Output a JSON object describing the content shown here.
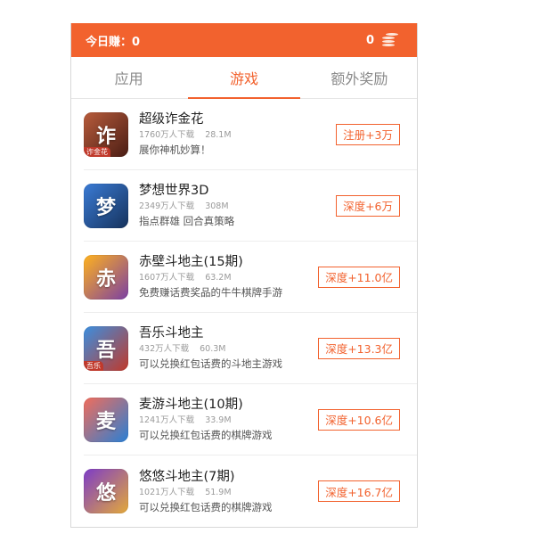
{
  "header": {
    "today_label": "今日赚：",
    "today_value": "0",
    "coin_value": "0",
    "coin_icon": "coin-stack-icon"
  },
  "tabs": [
    {
      "label": "应用",
      "active": false
    },
    {
      "label": "游戏",
      "active": true
    },
    {
      "label": "额外奖励",
      "active": false
    }
  ],
  "apps": [
    {
      "name": "超级诈金花",
      "downloads": "1760万人下载",
      "size": "28.1M",
      "desc": "展你神机妙算！",
      "reward": "注册+3万",
      "icon": "poker-girl-icon",
      "icon_text": "诈",
      "icon_badge": "诈金花",
      "colors": [
        "#b85c3c",
        "#4a1d14"
      ]
    },
    {
      "name": "梦想世界3D",
      "downloads": "2349万人下载",
      "size": "308M",
      "desc": "指点群雄 回合真策略",
      "reward": "深度+6万",
      "icon": "dream-world-icon",
      "icon_text": "梦",
      "icon_badge": "",
      "colors": [
        "#3a7bd5",
        "#16325c"
      ]
    },
    {
      "name": "赤壁斗地主(15期)",
      "downloads": "1607万人下载",
      "size": "63.2M",
      "desc": "免费赚话费奖品的牛牛棋牌手游",
      "reward": "深度+11.0亿",
      "icon": "card-cat-icon",
      "icon_text": "赤",
      "icon_badge": "",
      "colors": [
        "#ffb21e",
        "#7b3fa3"
      ]
    },
    {
      "name": "吾乐斗地主",
      "downloads": "432万人下载",
      "size": "60.3M",
      "desc": "可以兑换红包话费的斗地主游戏",
      "reward": "深度+13.3亿",
      "icon": "landlord-icon",
      "icon_text": "吾",
      "icon_badge": "吾乐",
      "colors": [
        "#3b8fe0",
        "#c0392b"
      ]
    },
    {
      "name": "麦游斗地主(10期)",
      "downloads": "1241万人下载",
      "size": "33.9M",
      "desc": "可以兑换红包话费的棋牌游戏",
      "reward": "深度+10.6亿",
      "icon": "cartoon-girl-icon",
      "icon_text": "麦",
      "icon_badge": "",
      "colors": [
        "#f26d5b",
        "#2a7fd4"
      ]
    },
    {
      "name": "悠悠斗地主(7期)",
      "downloads": "1021万人下载",
      "size": "51.9M",
      "desc": "可以兑换红包话费的棋牌游戏",
      "reward": "深度+16.7亿",
      "icon": "dancer-cards-icon",
      "icon_text": "悠",
      "icon_badge": "",
      "colors": [
        "#7d3cc8",
        "#e3a93a"
      ]
    }
  ],
  "accent_color": "#f2622e"
}
